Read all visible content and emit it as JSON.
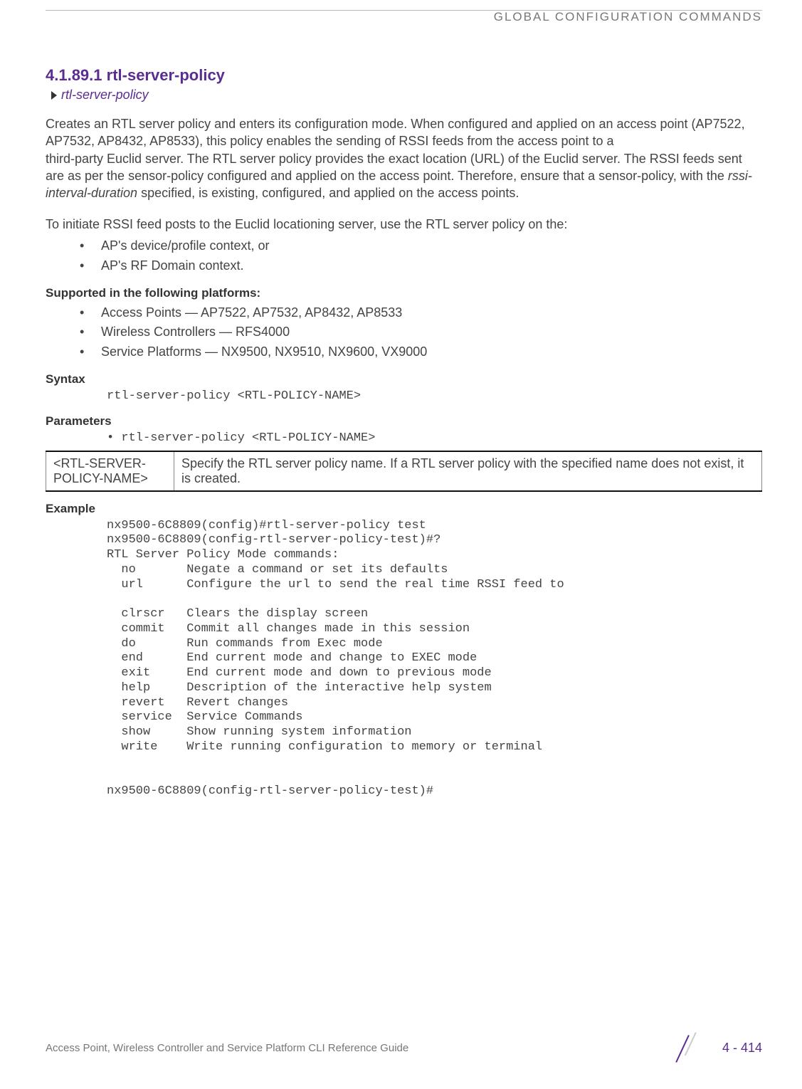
{
  "header": {
    "running_head": "GLOBAL CONFIGURATION COMMANDS"
  },
  "section": {
    "title": "4.1.89.1 rtl-server-policy",
    "breadcrumb": "rtl-server-policy"
  },
  "body": {
    "para1_a": "Creates an RTL server policy and enters its configuration mode. When configured and applied on an access point (AP7522, AP7532, AP8432, AP8533), this policy enables the sending of RSSI feeds from the access point to a",
    "para1_b": "third-party Euclid server. The RTL server policy provides the exact location (URL) of the Euclid server. The RSSI feeds sent are as per the sensor-policy configured and applied on the access point. Therefore, ensure that a sensor-policy, with the ",
    "para1_ital": "rssi-interval-duration",
    "para1_c": " specified, is existing, configured, and applied on the access points.",
    "para2": "To initiate RSSI feed posts to the Euclid locationing server, use the RTL server policy on the:",
    "list1": [
      "AP's device/profile context, or",
      "AP's RF Domain context."
    ],
    "supported_title": "Supported in the following platforms:",
    "supported": [
      "Access Points — AP7522, AP7532, AP8432, AP8533",
      "Wireless Controllers — RFS4000",
      "Service Platforms — NX9500, NX9510, NX9600, VX9000"
    ],
    "syntax_title": "Syntax",
    "syntax_code": "rtl-server-policy <RTL-POLICY-NAME>",
    "params_title": "Parameters",
    "params_leadin": "• rtl-server-policy <RTL-POLICY-NAME>",
    "param_table": {
      "key": "<RTL-SERVER-POLICY-NAME>",
      "desc": "Specify the RTL server policy name. If a RTL server policy with the specified name does not exist, it is created."
    },
    "example_title": "Example",
    "example_code": "nx9500-6C8809(config)#rtl-server-policy test\nnx9500-6C8809(config-rtl-server-policy-test)#?\nRTL Server Policy Mode commands:\n  no       Negate a command or set its defaults\n  url      Configure the url to send the real time RSSI feed to\n\n  clrscr   Clears the display screen\n  commit   Commit all changes made in this session\n  do       Run commands from Exec mode\n  end      End current mode and change to EXEC mode\n  exit     End current mode and down to previous mode\n  help     Description of the interactive help system\n  revert   Revert changes\n  service  Service Commands\n  show     Show running system information\n  write    Write running configuration to memory or terminal\n\n\nnx9500-6C8809(config-rtl-server-policy-test)#"
  },
  "footer": {
    "doc_title": "Access Point, Wireless Controller and Service Platform CLI Reference Guide",
    "page_num": "4 - 414"
  }
}
